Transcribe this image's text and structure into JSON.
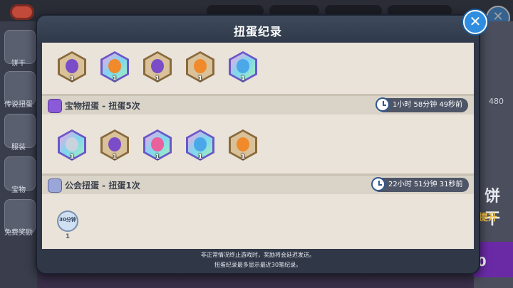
{
  "modal": {
    "title": "扭蛋纪录",
    "close_label": "✕"
  },
  "background": {
    "left_tabs": [
      "饼干",
      "传说扭蛋",
      "服装",
      "宝物",
      "免费奖励"
    ],
    "right_number": "480",
    "right_big_text": "饼干",
    "right_sub_text": "提升",
    "bottom_number": "0",
    "close_label": "✕"
  },
  "top_row": {
    "items": [
      {
        "icon": "purple-swirl-candy-icon",
        "count": "1",
        "frame": "bronze"
      },
      {
        "icon": "cookie-costume-icon",
        "count": "1",
        "frame": "rainbow"
      },
      {
        "icon": "purple-swirl-candy-icon",
        "count": "1",
        "frame": "bronze"
      },
      {
        "icon": "orange-potion-bottle-icon",
        "count": "1",
        "frame": "bronze"
      },
      {
        "icon": "treasure-trinket-icon",
        "count": "1",
        "frame": "rainbow"
      }
    ]
  },
  "section_treasure": {
    "title": "宝物扭蛋 - 扭蛋5次",
    "time": "1小时 58分钟 49秒前",
    "icon": "treasure-capsule-icon",
    "items": [
      {
        "icon": "silver-ghost-treasure-icon",
        "count": "1",
        "frame": "rainbow"
      },
      {
        "icon": "purple-swirl-candy-icon",
        "count": "1",
        "frame": "bronze"
      },
      {
        "icon": "pink-flamingo-treasure-icon",
        "count": "1",
        "frame": "rainbow"
      },
      {
        "icon": "crystal-orb-treasure-icon",
        "count": "1",
        "frame": "rainbow"
      },
      {
        "icon": "orange-potion-bottle-icon",
        "count": "1",
        "frame": "bronze"
      }
    ]
  },
  "section_guild": {
    "title": "公会扭蛋 - 扭蛋1次",
    "time": "22小时 51分钟 31秒前",
    "icon": "guild-capsule-icon",
    "items": [
      {
        "icon": "time-boost-badge-icon",
        "badge_text": "30分钟",
        "count": "1"
      }
    ]
  },
  "footer": {
    "line1": "非正常情况终止游戏时，奖励将会延迟发送。",
    "line2": "扭蛋纪录最多显示最近30笔纪录。"
  },
  "colors": {
    "bronze_outer": "#8a6a3c",
    "bronze_inner": "#d9c29a",
    "rainbow_outer": "#6a58c8",
    "rainbow_inner": "#7fd6f0",
    "purple_art": "#7a4cc8",
    "orange_art": "#f08a2a",
    "pink_art": "#e8609c",
    "silver_art": "#c9d3de",
    "blue_art": "#4aa8e8"
  }
}
